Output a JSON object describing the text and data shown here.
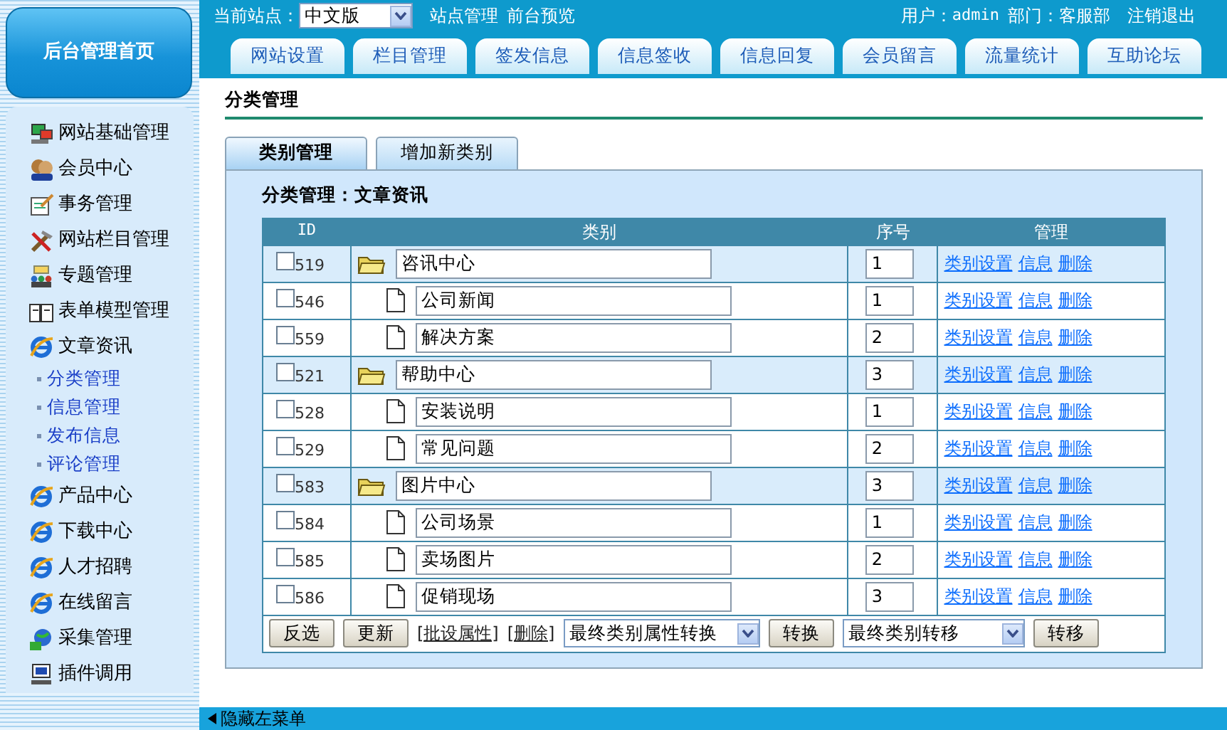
{
  "sidebar": {
    "home_button": "后台管理首页",
    "items": [
      {
        "label": "网站基础管理"
      },
      {
        "label": "会员中心"
      },
      {
        "label": "事务管理"
      },
      {
        "label": "网站栏目管理"
      },
      {
        "label": "专题管理"
      },
      {
        "label": "表单模型管理"
      },
      {
        "label": "文章资讯",
        "children": [
          {
            "label": "分类管理"
          },
          {
            "label": "信息管理"
          },
          {
            "label": "发布信息"
          },
          {
            "label": "评论管理"
          }
        ]
      },
      {
        "label": "产品中心"
      },
      {
        "label": "下载中心"
      },
      {
        "label": "人才招聘"
      },
      {
        "label": "在线留言"
      },
      {
        "label": "采集管理"
      },
      {
        "label": "插件调用"
      }
    ]
  },
  "header": {
    "site_label": "当前站点：",
    "site_select": "中文版",
    "links": [
      "站点管理",
      "前台预览"
    ],
    "user_label": "用户：",
    "user": "admin",
    "dept": "部门：客服部",
    "logout": "注销退出"
  },
  "nav_tabs": [
    "网站设置",
    "栏目管理",
    "签发信息",
    "信息签收",
    "信息回复",
    "会员留言",
    "流量统计",
    "互助论坛"
  ],
  "page_title": "分类管理",
  "sub_tabs": [
    {
      "label": "类别管理",
      "selected": true
    },
    {
      "label": "增加新类别",
      "selected": false
    }
  ],
  "section_title": "分类管理：文章资讯",
  "table": {
    "columns": [
      "ID",
      "类别",
      "序号",
      "管理"
    ],
    "rows": [
      {
        "id": "519",
        "checked": false,
        "name": "咨讯中心",
        "order": "1",
        "actions": [
          "类别设置",
          "信息",
          "删除"
        ],
        "children": [
          {
            "id": "546",
            "checked": false,
            "name": "公司新闻",
            "order": "1",
            "actions": [
              "类别设置",
              "信息",
              "删除"
            ]
          },
          {
            "id": "559",
            "checked": false,
            "name": "解决方案",
            "order": "2",
            "actions": [
              "类别设置",
              "信息",
              "删除"
            ]
          }
        ]
      },
      {
        "id": "521",
        "checked": false,
        "name": "帮助中心",
        "order": "3",
        "actions": [
          "类别设置",
          "信息",
          "删除"
        ],
        "children": [
          {
            "id": "528",
            "checked": false,
            "name": "安装说明",
            "order": "1",
            "actions": [
              "类别设置",
              "信息",
              "删除"
            ]
          },
          {
            "id": "529",
            "checked": false,
            "name": "常见问题",
            "order": "2",
            "actions": [
              "类别设置",
              "信息",
              "删除"
            ]
          }
        ]
      },
      {
        "id": "583",
        "checked": false,
        "name": "图片中心",
        "order": "3",
        "actions": [
          "类别设置",
          "信息",
          "删除"
        ],
        "children": [
          {
            "id": "584",
            "checked": false,
            "name": "公司场景",
            "order": "1",
            "actions": [
              "类别设置",
              "信息",
              "删除"
            ]
          },
          {
            "id": "585",
            "checked": false,
            "name": "卖场图片",
            "order": "2",
            "actions": [
              "类别设置",
              "信息",
              "删除"
            ]
          },
          {
            "id": "586",
            "checked": false,
            "name": "促销现场",
            "order": "3",
            "actions": [
              "类别设置",
              "信息",
              "删除"
            ]
          }
        ]
      }
    ]
  },
  "footer_controls": [
    {
      "kind": "button",
      "label": "反选"
    },
    {
      "kind": "button",
      "label": "更新"
    },
    {
      "kind": "link",
      "label": "[批设属性]"
    },
    {
      "kind": "link",
      "label": "[删除]"
    },
    {
      "kind": "select",
      "label": "最终类别属性转换"
    },
    {
      "kind": "button",
      "label": "转换"
    },
    {
      "kind": "select",
      "label": "最终类别转移"
    },
    {
      "kind": "button",
      "label": "转移"
    }
  ],
  "bottom_bar": {
    "toggle": "隐藏左菜单"
  }
}
